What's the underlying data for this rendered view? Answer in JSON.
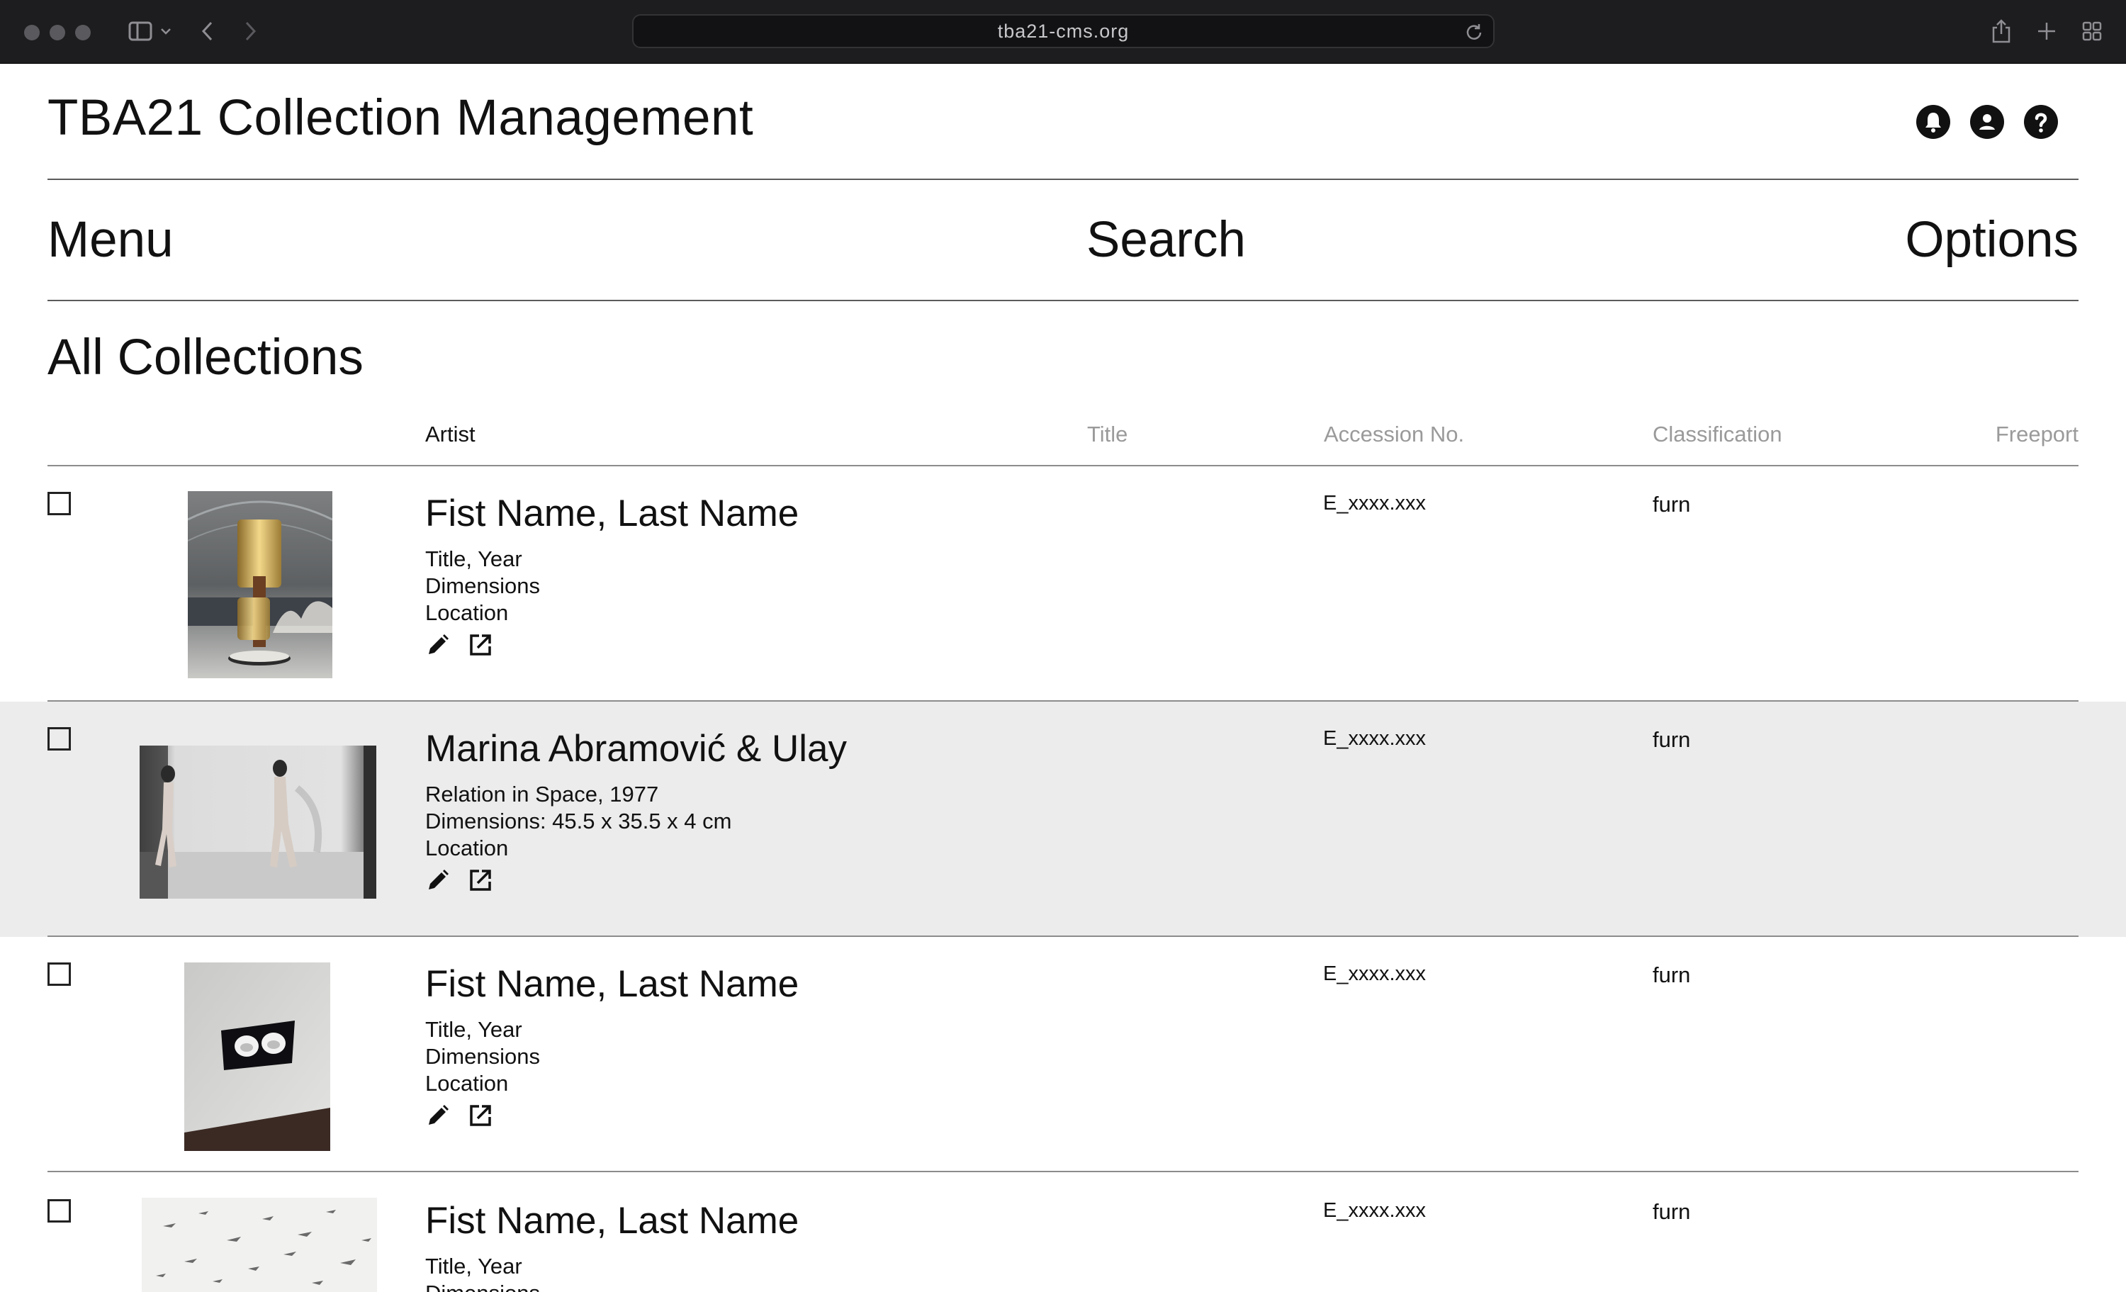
{
  "browser": {
    "url": "tba21-cms.org"
  },
  "app": {
    "title": "TBA21 Collection Management",
    "icons": [
      "bell-icon",
      "account-icon",
      "help-icon"
    ]
  },
  "nav": {
    "menu": "Menu",
    "search": "Search",
    "options": "Options"
  },
  "section": {
    "title": "All Collections"
  },
  "columns": {
    "artist": "Artist",
    "title": "Title",
    "accession": "Accession No.",
    "classification": "Classification",
    "freeport": "Freeport"
  },
  "rows": [
    {
      "artist": "Fist Name, Last Name",
      "line1": "Title, Year",
      "line2": "Dimensions",
      "line3": "Location",
      "accession": "E_xxxx.xxx",
      "classification": "furn"
    },
    {
      "artist": "Marina Abramović & Ulay",
      "line1": "Relation in Space, 1977",
      "line2": "Dimensions: 45.5 x 35.5 x 4 cm",
      "line3": "Location",
      "accession": "E_xxxx.xxx",
      "classification": "furn"
    },
    {
      "artist": "Fist Name, Last Name",
      "line1": "Title, Year",
      "line2": "Dimensions",
      "line3": "Location",
      "accession": "E_xxxx.xxx",
      "classification": "furn"
    },
    {
      "artist": "Fist Name, Last Name",
      "line1": "Title, Year",
      "line2": "Dimensions",
      "line3": "",
      "accession": "E_xxxx.xxx",
      "classification": "furn"
    }
  ]
}
